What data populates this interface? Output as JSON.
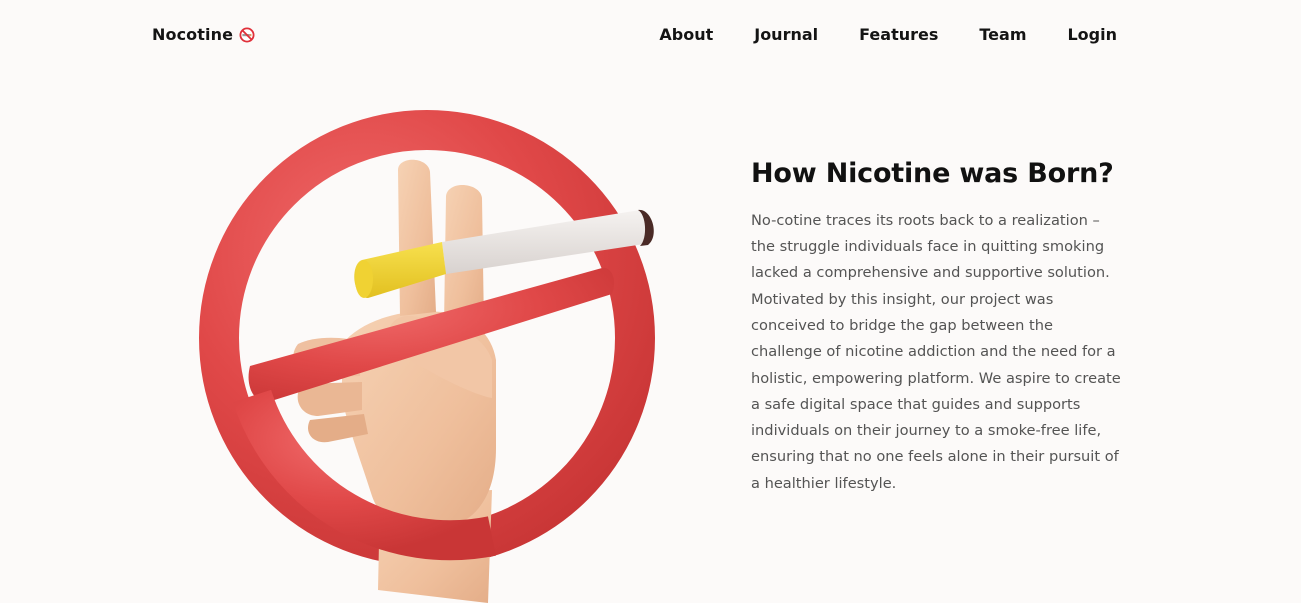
{
  "nav": {
    "brand": "Nocotine",
    "brand_icon": "no-smoking-icon",
    "links": [
      {
        "label": "About"
      },
      {
        "label": "Journal"
      },
      {
        "label": "Features"
      },
      {
        "label": "Team"
      },
      {
        "label": "Login"
      }
    ]
  },
  "hero": {
    "illustration": "no-smoking-hand-illustration",
    "title": "How Nicotine was Born?",
    "body": "No-cotine traces its roots back to a realization – the struggle individuals face in quitting smoking lacked a comprehensive and supportive solution. Motivated by this insight, our project was conceived to bridge the gap between the challenge of nicotine addiction and the need for a holistic, empowering platform. We aspire to create a safe digital space that guides and supports individuals on their journey to a smoke-free life, ensuring that no one feels alone in their pursuit of a healthier lifestyle."
  },
  "colors": {
    "background": "#fcfaf9",
    "text_primary": "#141414",
    "text_body": "#545454",
    "ring_red": "#e04848",
    "skin": "#f1c2a0",
    "filter_yellow": "#f0d233"
  }
}
